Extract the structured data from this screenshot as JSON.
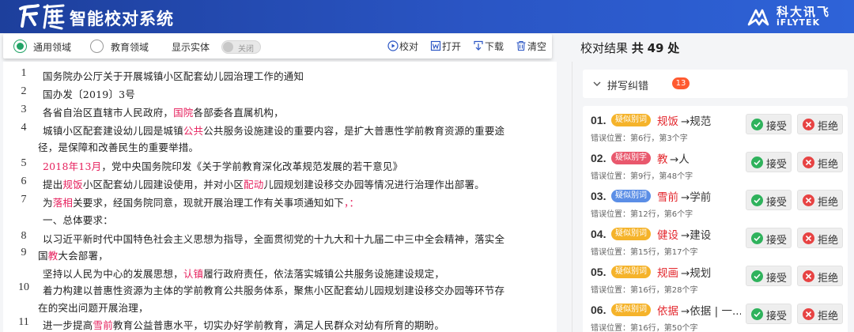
{
  "header": {
    "logo_mark": "飞鹰",
    "title": "智能校对系统",
    "brand_cn": "科大讯飞",
    "brand_en": "iFLYTEK",
    "colors": {
      "bar": "#2a55c4",
      "accent": "#21a366"
    }
  },
  "toolbar": {
    "option_general": "通用领域",
    "option_education": "教育领域",
    "show_entity_label": "显示实体",
    "switch_state": "关闭",
    "proofread": "校对",
    "open": "打开",
    "download": "下载",
    "clear": "清空"
  },
  "document": {
    "lines": [
      {
        "num": "1",
        "segments": [
          {
            "t": "国务院办公厅关于开展城镇小区配套幼儿园治理工作的通知"
          }
        ]
      },
      {
        "num": "2",
        "segments": [
          {
            "t": "国办发〔2019〕3号"
          }
        ]
      },
      {
        "num": "3",
        "segments": [
          {
            "t": "各省自治区直辖市人民政府，"
          },
          {
            "t": "国院",
            "hl": true
          },
          {
            "t": "各部委各直属机构，"
          }
        ]
      },
      {
        "num": "4",
        "segments": [
          {
            "t": "城镇小区配套建设幼儿园是城镇"
          },
          {
            "t": "公共",
            "hl": true
          },
          {
            "t": "公共服务设施建设的重要内容，是扩大普惠性学前教育资源的重要途"
          }
        ]
      },
      {
        "num": "",
        "segments": [
          {
            "t": "径，是保障和改善民生的重要举措。"
          }
        ]
      },
      {
        "num": "5",
        "segments": [
          {
            "t": "2018年13月",
            "hl": true
          },
          {
            "t": "，党中央国务院印发《关于学前教育深化改革规范发展的若干意见》"
          }
        ]
      },
      {
        "num": "6",
        "segments": [
          {
            "t": "提出"
          },
          {
            "t": "规饭",
            "hl": true
          },
          {
            "t": "小区配套幼儿园建设使用，并对小区"
          },
          {
            "t": "配动",
            "hl": true
          },
          {
            "t": "儿园规划建设移交办园等情况进行治理作出部署。"
          }
        ]
      },
      {
        "num": "7",
        "segments": [
          {
            "t": "为"
          },
          {
            "t": "落相",
            "hl": true
          },
          {
            "t": "关要求，经国务院同意，现就开展治理工作有关事项通知如下"
          },
          {
            "t": "，：",
            "hl": true
          }
        ]
      },
      {
        "num": "",
        "segments": [
          {
            "t": "一、总体要求："
          }
        ]
      },
      {
        "num": "8",
        "segments": [
          {
            "t": "以习近平新时代中国特色社会主义思想为指导，全面贯彻党的十九大和十九届二中三中全会精神，落实全"
          }
        ]
      },
      {
        "num": "9",
        "segments": [
          {
            "t": "国"
          },
          {
            "t": "教",
            "hl": true
          },
          {
            "t": "大会部署，"
          }
        ]
      },
      {
        "num": "",
        "segments": [
          {
            "t": "坚持以人民为中心的发展思想，"
          },
          {
            "t": "认镇",
            "hl": true
          },
          {
            "t": "履行政府责任，依法落实城镇公共服务设施建设规定，"
          }
        ]
      },
      {
        "num": "10",
        "segments": [
          {
            "t": "着力构建以普惠性资源为主体的学前教育公共服务体系，聚焦小区配套幼儿园规划建设移交办园等环节存"
          }
        ]
      },
      {
        "num": "",
        "segments": [
          {
            "t": "在的突出问题开展治理，"
          }
        ]
      },
      {
        "num": "11",
        "segments": [
          {
            "t": "进一步提高"
          },
          {
            "t": "雪前",
            "hl": true
          },
          {
            "t": "教育公益普惠水平，切实办好学前教育，满足人民群众对幼有所育的期盼。"
          }
        ]
      }
    ]
  },
  "results": {
    "label": "校对结果",
    "total_prefix": "共",
    "total": "49",
    "total_suffix": "处",
    "group": {
      "title": "拼写纠错",
      "count": "13"
    },
    "accept_label": "接受",
    "reject_label": "拒绝",
    "items": [
      {
        "num": "01.",
        "tag": "疑似别词",
        "tag_color": "#f5b32a",
        "orig": "规饭",
        "suggest": "→规范",
        "loc": "错误位置：第6行，第3个字"
      },
      {
        "num": "02.",
        "tag": "疑似别字",
        "tag_color": "#e9586d",
        "orig": "教",
        "suggest": "→人",
        "loc": "错误位置：第9行，第48个字"
      },
      {
        "num": "03.",
        "tag": "疑似别词",
        "tag_color": "#5b8ee6",
        "orig": "雪前",
        "suggest": "→学前",
        "loc": "错误位置：第12行，第6个字"
      },
      {
        "num": "04.",
        "tag": "疑似别词",
        "tag_color": "#f5b32a",
        "orig": "健设",
        "suggest": "→建设",
        "loc": "错误位置：第15行，第17个字"
      },
      {
        "num": "05.",
        "tag": "疑似别词",
        "tag_color": "#f5b32a",
        "orig": "规画",
        "suggest": "→规划",
        "loc": "错误位置：第16行，第28个字"
      },
      {
        "num": "06.",
        "tag": "疑似别词",
        "tag_color": "#f5b32a",
        "orig": "依据",
        "suggest": "→依据 | 一...",
        "loc": "错误位置：第16行，第50个字"
      }
    ]
  }
}
